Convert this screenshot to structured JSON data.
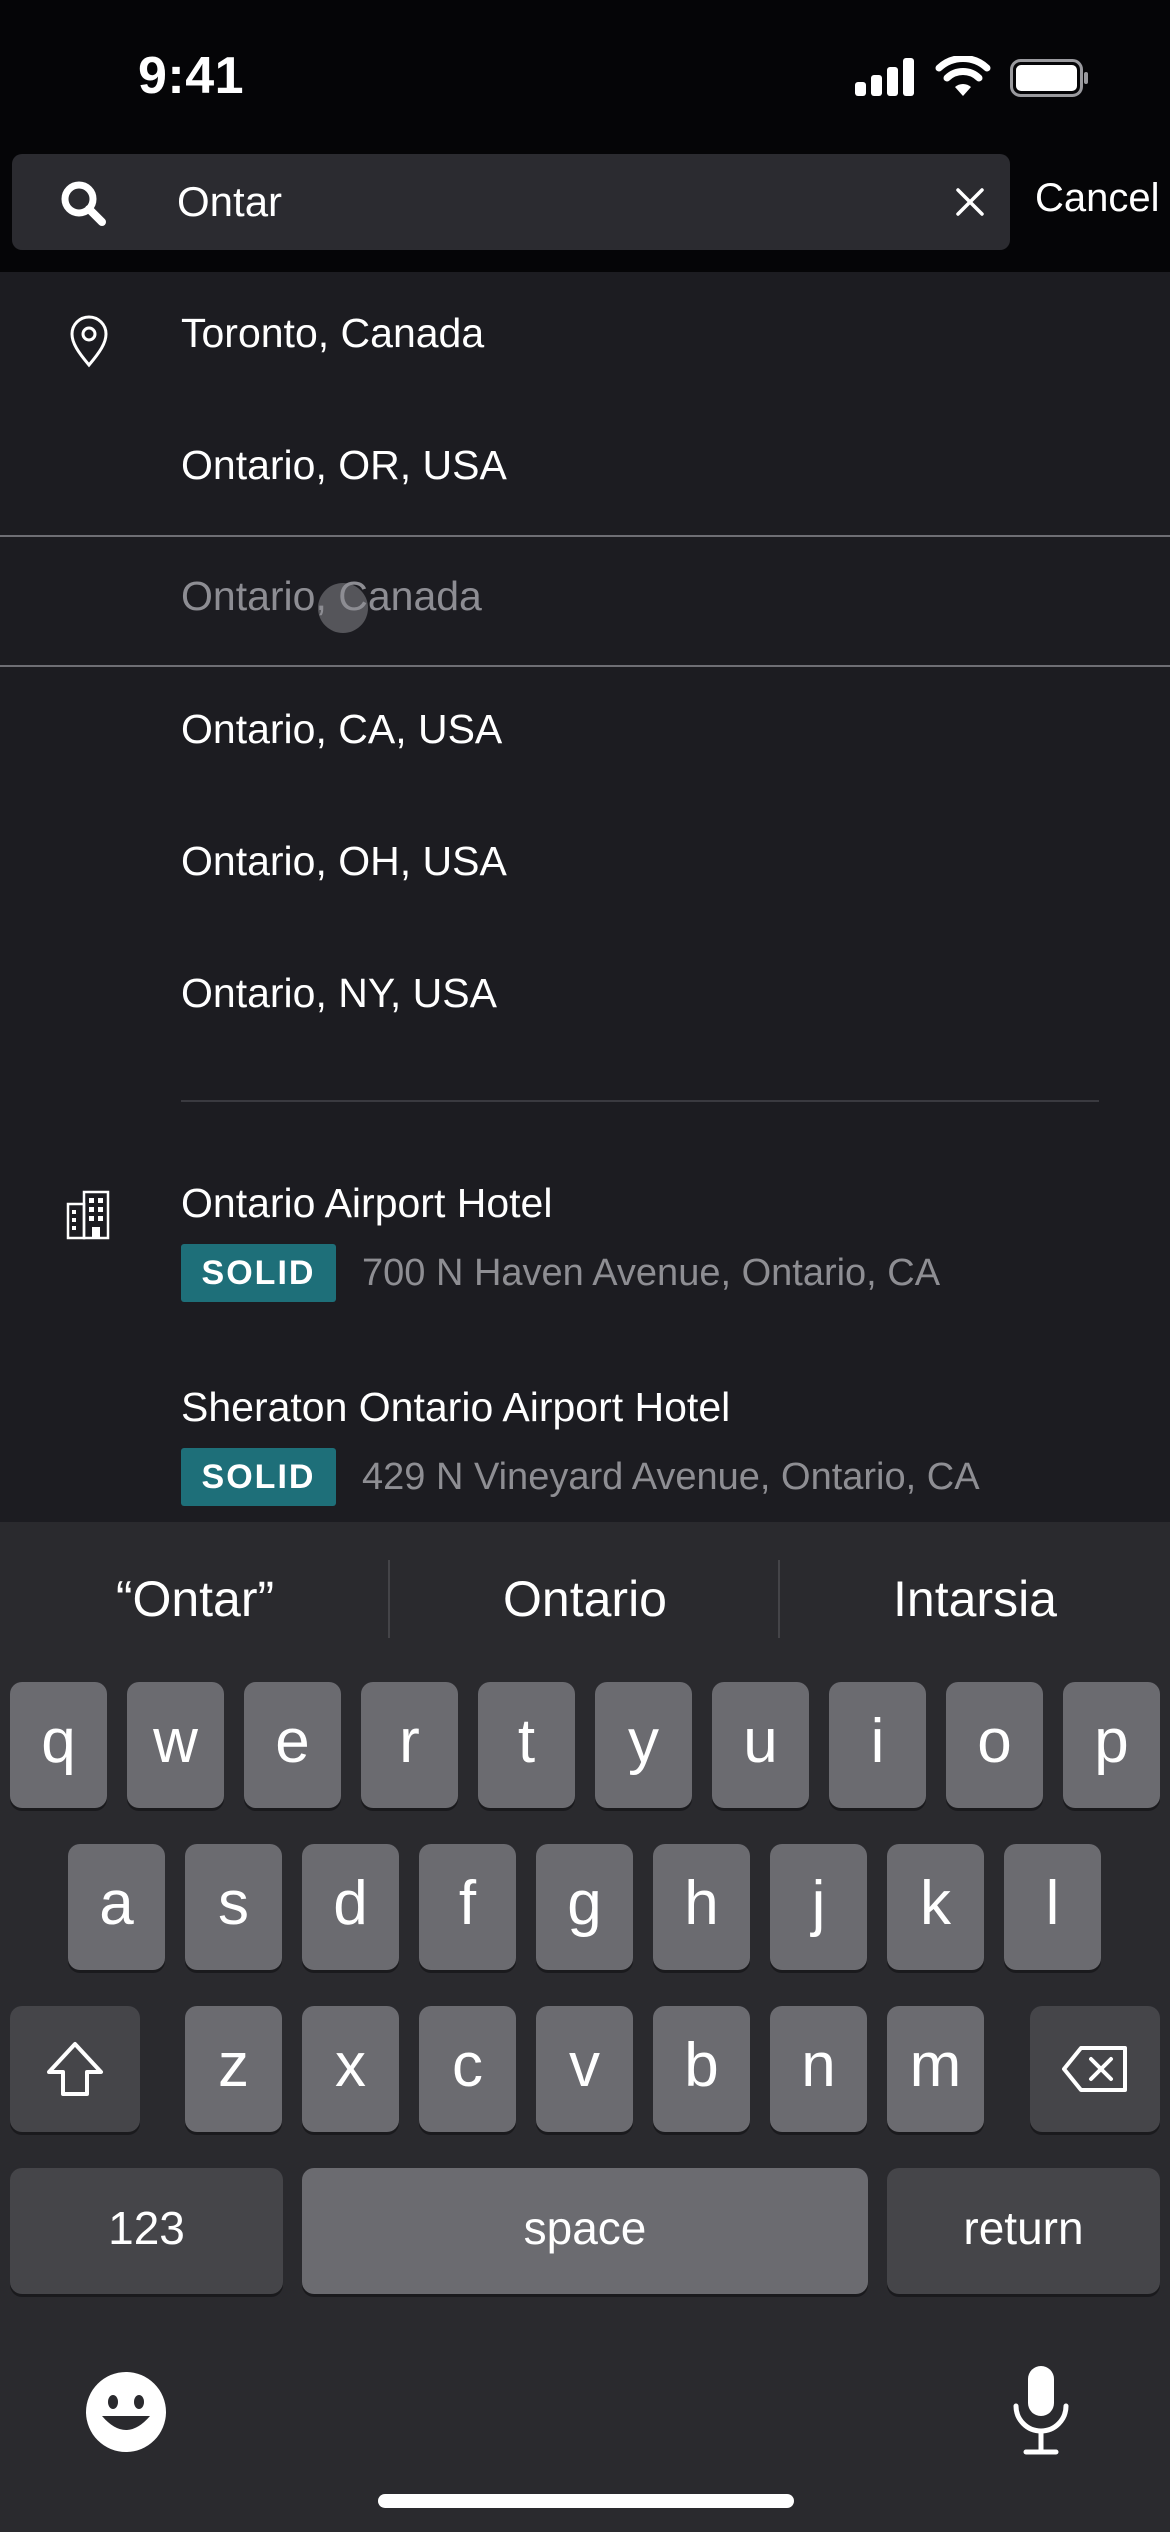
{
  "status_bar": {
    "time": "9:41"
  },
  "search": {
    "query": "Ontar",
    "cancel_label": "Cancel"
  },
  "results": {
    "places": [
      {
        "label": "Toronto, Canada",
        "icon": "location-pin-icon"
      },
      {
        "label": "Ontario, OR, USA"
      },
      {
        "label": "Ontario, Canada",
        "pressed": true
      },
      {
        "label": "Ontario, CA, USA"
      },
      {
        "label": "Ontario, OH, USA"
      },
      {
        "label": "Ontario, NY, USA"
      }
    ],
    "hotels": [
      {
        "name": "Ontario Airport Hotel",
        "badge": "SOLID",
        "address": "700 N Haven Avenue, Ontario, CA",
        "icon": "hotel-building-icon"
      },
      {
        "name": "Sheraton Ontario Airport Hotel",
        "badge": "SOLID",
        "address": "429 N Vineyard Avenue, Ontario, CA"
      }
    ]
  },
  "keyboard": {
    "suggestions": [
      "“Ontar”",
      "Ontario",
      "Intarsia"
    ],
    "row1": [
      "q",
      "w",
      "e",
      "r",
      "t",
      "y",
      "u",
      "i",
      "o",
      "p"
    ],
    "row2": [
      "a",
      "s",
      "d",
      "f",
      "g",
      "h",
      "j",
      "k",
      "l"
    ],
    "row3": [
      "z",
      "x",
      "c",
      "v",
      "b",
      "n",
      "m"
    ],
    "numbers_label": "123",
    "space_label": "space",
    "return_label": "return"
  },
  "colors": {
    "badge": "#1e6f79",
    "background": "#1c1c21",
    "keyboard": "#2a2a2e"
  }
}
